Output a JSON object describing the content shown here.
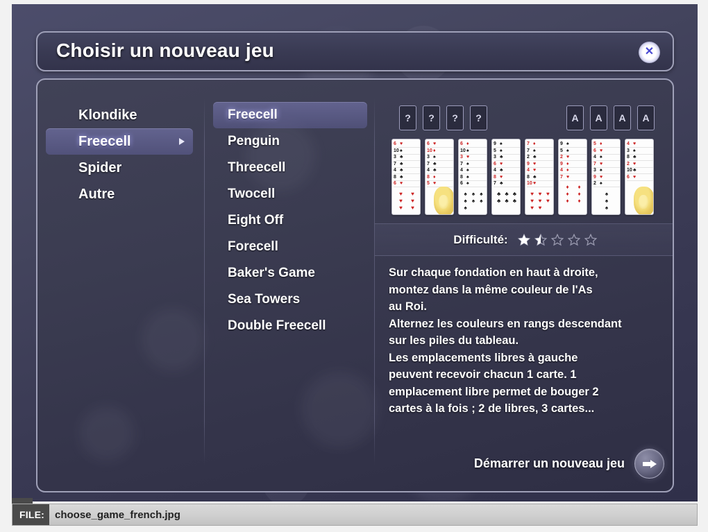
{
  "window": {
    "title": "Choisir un nouveau jeu",
    "close_icon": "close-icon",
    "close_glyph": "✕"
  },
  "categories": [
    {
      "label": "Klondike",
      "selected": false,
      "has_arrow": false
    },
    {
      "label": "Freecell",
      "selected": true,
      "has_arrow": true
    },
    {
      "label": "Spider",
      "selected": false,
      "has_arrow": false
    },
    {
      "label": "Autre",
      "selected": false,
      "has_arrow": false
    }
  ],
  "games": [
    {
      "label": "Freecell",
      "selected": true
    },
    {
      "label": "Penguin",
      "selected": false
    },
    {
      "label": "Threecell",
      "selected": false
    },
    {
      "label": "Twocell",
      "selected": false
    },
    {
      "label": "Eight Off",
      "selected": false
    },
    {
      "label": "Forecell",
      "selected": false
    },
    {
      "label": "Baker's Game",
      "selected": false
    },
    {
      "label": "Sea Towers",
      "selected": false
    },
    {
      "label": "Double Freecell",
      "selected": false
    }
  ],
  "preview": {
    "free_cells": [
      "?",
      "?",
      "?",
      "?"
    ],
    "foundations": [
      "A",
      "A",
      "A",
      "A"
    ],
    "tableau": [
      {
        "joker": false,
        "cards": [
          {
            "rank": "6",
            "suit": "♥",
            "color": "red"
          },
          {
            "rank": "10",
            "suit": "♠",
            "color": "black"
          },
          {
            "rank": "3",
            "suit": "♣",
            "color": "black"
          },
          {
            "rank": "7",
            "suit": "♣",
            "color": "black"
          },
          {
            "rank": "4",
            "suit": "♣",
            "color": "black"
          },
          {
            "rank": "8",
            "suit": "♣",
            "color": "black"
          },
          {
            "rank": "6",
            "suit": "♥",
            "color": "red"
          }
        ],
        "bottom_pips": 6,
        "bottom_color": "red",
        "bottom_suit": "♥",
        "bottom_cols": 2
      },
      {
        "joker": true,
        "cards": [
          {
            "rank": "6",
            "suit": "♥",
            "color": "red"
          },
          {
            "rank": "10",
            "suit": "♦",
            "color": "red"
          },
          {
            "rank": "3",
            "suit": "♠",
            "color": "black"
          },
          {
            "rank": "7",
            "suit": "♣",
            "color": "black"
          },
          {
            "rank": "4",
            "suit": "♣",
            "color": "black"
          },
          {
            "rank": "8",
            "suit": "♦",
            "color": "red"
          },
          {
            "rank": "5",
            "suit": "♥",
            "color": "red"
          }
        ],
        "bottom_pips": 0,
        "bottom_color": "red",
        "bottom_suit": "♥",
        "bottom_cols": 2
      },
      {
        "joker": false,
        "cards": [
          {
            "rank": "6",
            "suit": "♦",
            "color": "red"
          },
          {
            "rank": "10",
            "suit": "♠",
            "color": "black"
          },
          {
            "rank": "3",
            "suit": "♥",
            "color": "red"
          },
          {
            "rank": "7",
            "suit": "♠",
            "color": "black"
          },
          {
            "rank": "4",
            "suit": "♠",
            "color": "black"
          },
          {
            "rank": "8",
            "suit": "♠",
            "color": "black"
          },
          {
            "rank": "6",
            "suit": "♠",
            "color": "black"
          }
        ],
        "bottom_pips": 7,
        "bottom_color": "black",
        "bottom_suit": "♠",
        "bottom_cols": 3
      },
      {
        "joker": false,
        "cards": [
          {
            "rank": "9",
            "suit": "♠",
            "color": "black"
          },
          {
            "rank": "5",
            "suit": "♠",
            "color": "black"
          },
          {
            "rank": "3",
            "suit": "♣",
            "color": "black"
          },
          {
            "rank": "6",
            "suit": "♥",
            "color": "red"
          },
          {
            "rank": "4",
            "suit": "♣",
            "color": "black"
          },
          {
            "rank": "8",
            "suit": "♥",
            "color": "red"
          },
          {
            "rank": "7",
            "suit": "♣",
            "color": "black"
          }
        ],
        "bottom_pips": 6,
        "bottom_color": "black",
        "bottom_suit": "♣",
        "bottom_cols": 3
      },
      {
        "joker": false,
        "cards": [
          {
            "rank": "7",
            "suit": "♦",
            "color": "red"
          },
          {
            "rank": "7",
            "suit": "♠",
            "color": "black"
          },
          {
            "rank": "2",
            "suit": "♣",
            "color": "black"
          },
          {
            "rank": "9",
            "suit": "♥",
            "color": "red"
          },
          {
            "rank": "4",
            "suit": "♥",
            "color": "red"
          },
          {
            "rank": "8",
            "suit": "♣",
            "color": "black"
          },
          {
            "rank": "10",
            "suit": "♥",
            "color": "red"
          }
        ],
        "bottom_pips": 8,
        "bottom_color": "red",
        "bottom_suit": "♥",
        "bottom_cols": 3
      },
      {
        "joker": false,
        "cards": [
          {
            "rank": "9",
            "suit": "♠",
            "color": "black"
          },
          {
            "rank": "5",
            "suit": "♠",
            "color": "black"
          },
          {
            "rank": "2",
            "suit": "♥",
            "color": "red"
          },
          {
            "rank": "9",
            "suit": "♦",
            "color": "red"
          },
          {
            "rank": "4",
            "suit": "♦",
            "color": "red"
          },
          {
            "rank": "7",
            "suit": "♥",
            "color": "red"
          }
        ],
        "bottom_pips": 6,
        "bottom_color": "red",
        "bottom_suit": "♦",
        "bottom_cols": 2
      },
      {
        "joker": false,
        "cards": [
          {
            "rank": "5",
            "suit": "♦",
            "color": "red"
          },
          {
            "rank": "6",
            "suit": "♥",
            "color": "red"
          },
          {
            "rank": "4",
            "suit": "♠",
            "color": "black"
          },
          {
            "rank": "7",
            "suit": "♥",
            "color": "red"
          },
          {
            "rank": "3",
            "suit": "♠",
            "color": "black"
          },
          {
            "rank": "9",
            "suit": "♥",
            "color": "red"
          },
          {
            "rank": "2",
            "suit": "♠",
            "color": "black"
          }
        ],
        "bottom_pips": 3,
        "bottom_color": "black",
        "bottom_suit": "♠",
        "bottom_cols": 1
      },
      {
        "joker": true,
        "cards": [
          {
            "rank": "4",
            "suit": "♥",
            "color": "red"
          },
          {
            "rank": "3",
            "suit": "♠",
            "color": "black"
          },
          {
            "rank": "8",
            "suit": "♣",
            "color": "black"
          },
          {
            "rank": "2",
            "suit": "♥",
            "color": "red"
          },
          {
            "rank": "10",
            "suit": "♣",
            "color": "black"
          },
          {
            "rank": "6",
            "suit": "♥",
            "color": "red"
          }
        ],
        "bottom_pips": 0,
        "bottom_color": "red",
        "bottom_suit": "♥",
        "bottom_cols": 2
      }
    ]
  },
  "difficulty": {
    "label": "Difficulté:",
    "value": 1.5,
    "max": 5
  },
  "description": "Sur chaque fondation en haut à droite,\nmontez dans la même couleur de l'As\nau Roi.\nAlternez les couleurs en rangs descendant\nsur les piles du tableau.\nLes emplacements libres à gauche\npeuvent recevoir chacun 1 carte. 1\nemplacement libre permet de bouger 2\ncartes à la fois ; 2 de libres, 3 cartes...",
  "start": {
    "label": "Démarrer un nouveau jeu",
    "arrow_icon": "arrow-right-icon"
  },
  "file_bar": {
    "badge": "FILE:",
    "name": "choose_game_french.jpg"
  },
  "colors": {
    "panel_border": "#9fa0b8",
    "selection": "#8080be",
    "bg_dark": "#30304a",
    "bg_light": "#4c4d6b",
    "text": "#ffffff",
    "card_red": "#cc2222",
    "card_black": "#111111"
  }
}
